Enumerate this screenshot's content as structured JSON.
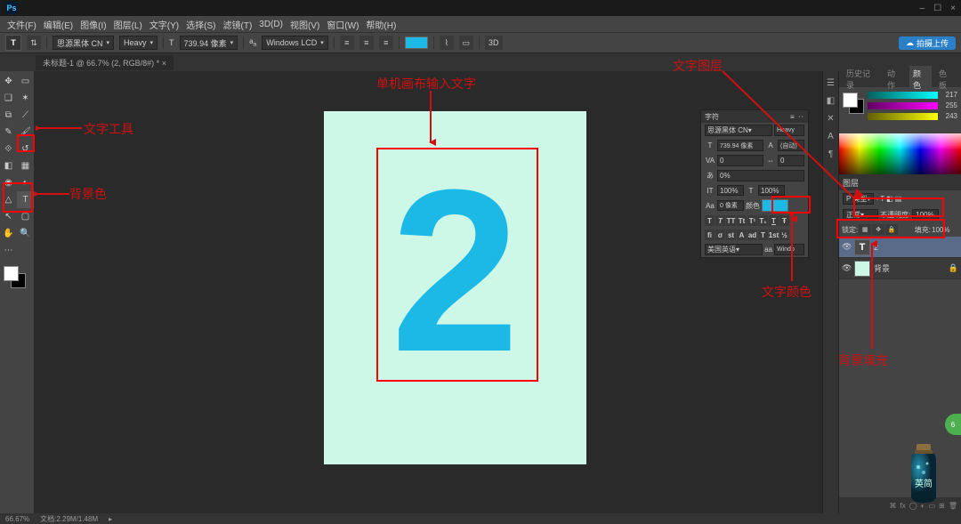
{
  "app": {
    "logo": "Ps"
  },
  "window_controls": {
    "min": "–",
    "max": "☐",
    "close": "×"
  },
  "menu": [
    "文件(F)",
    "编辑(E)",
    "图像(I)",
    "图层(L)",
    "文字(Y)",
    "选择(S)",
    "滤镜(T)",
    "3D(D)",
    "视图(V)",
    "窗口(W)",
    "帮助(H)"
  ],
  "options": {
    "font_family": "思源黑体 CN",
    "font_weight": "Heavy",
    "font_size": "739.94 像素",
    "aa": "Windows LCD",
    "upload": "拍摄上传"
  },
  "doc_tab": "未标题-1 @ 66.7% (2, RGB/8#) *",
  "canvas": {
    "text": "2"
  },
  "char_panel": {
    "title": "字符",
    "font_family": "思源黑体 CN",
    "font_weight": "Heavy",
    "size": "739.94 像素",
    "leading": "(自动)",
    "tracking": "0",
    "kerning": "0%",
    "vscale": "100%",
    "baseline": "0 像素",
    "color_label": "颜色",
    "lang": "美国英语",
    "aa": "Windo",
    "metrics": "VA"
  },
  "panels": {
    "tabs": {
      "history": "历史记录",
      "actions": "动作",
      "color": "颜色",
      "swatches": "色板"
    },
    "sliders": {
      "a": "217",
      "b": "255",
      "c": "243"
    },
    "layers_title": "图层",
    "kind": "P 类型",
    "blend": "正常",
    "opacity_label": "不透明度:",
    "opacity_val": "100%",
    "lock_label": "锁定:",
    "fill_label": "填充:",
    "fill_val": "100%",
    "layer1": "2",
    "layer2": "背景"
  },
  "status": {
    "zoom": "66.67%",
    "doc": "文档:2.29M/1.48M"
  },
  "annotations": {
    "tool": "文字工具",
    "bgcolor": "背景色",
    "canvas": "单机画布输入文字",
    "textlayer": "文字图层",
    "textcolor": "文字颜色",
    "bgfill": "背景填充"
  },
  "bottle_label": "英简"
}
